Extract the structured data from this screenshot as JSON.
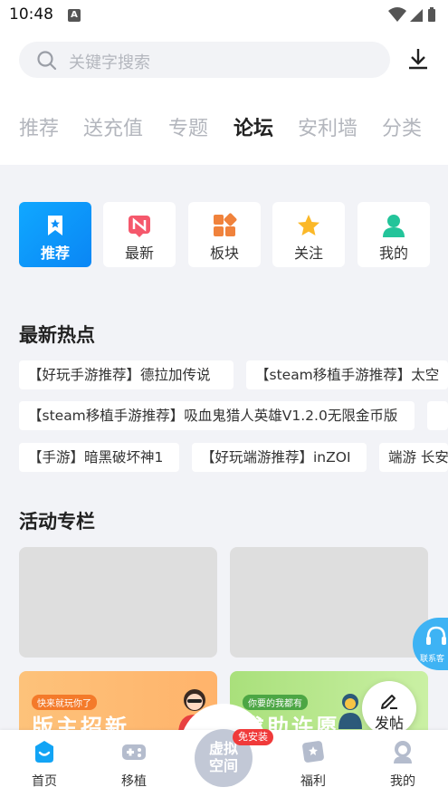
{
  "status_bar": {
    "time": "10:48",
    "notification_letter": "A"
  },
  "search": {
    "placeholder": "关键字搜索"
  },
  "tabs": [
    {
      "label": "推荐"
    },
    {
      "label": "送充值"
    },
    {
      "label": "专题"
    },
    {
      "label": "论坛",
      "active": true
    },
    {
      "label": "安利墙"
    },
    {
      "label": "分类"
    }
  ],
  "quick_nav": [
    {
      "label": "推荐",
      "icon": "bookmark-star-icon",
      "active": true
    },
    {
      "label": "最新",
      "icon": "new-badge-icon"
    },
    {
      "label": "板块",
      "icon": "blocks-icon"
    },
    {
      "label": "关注",
      "icon": "star-icon"
    },
    {
      "label": "我的",
      "icon": "user-icon"
    }
  ],
  "hot": {
    "title": "最新热点",
    "rows": [
      [
        "【好玩手游推荐】德拉加传说",
        "【steam移植手游推荐】太空"
      ],
      [
        "【steam移植手游推荐】吸血鬼猎人英雄V1.2.0无限金币版"
      ],
      [
        "【手游】暗黑破坏神1",
        "【好玩端游推荐】inZOI",
        "端游 长安"
      ]
    ]
  },
  "activity": {
    "title": "活动专栏",
    "promos": [
      {
        "tag": "快来就玩你了",
        "headline": "版主招新"
      },
      {
        "tag": "你要的我都有",
        "headline": "求助许愿"
      }
    ]
  },
  "floating": {
    "service_label": "联系客",
    "post_label": "发帖"
  },
  "bottom_nav": {
    "items": [
      {
        "label": "首页",
        "icon": "home-icon",
        "active": true
      },
      {
        "label": "移植",
        "icon": "gamepad-icon"
      },
      {
        "label": "福利",
        "icon": "gift-card-icon"
      },
      {
        "label": "我的",
        "icon": "profile-icon"
      }
    ],
    "center": {
      "line1": "虚拟",
      "line2": "空间",
      "badge": "免安装"
    }
  },
  "colors": {
    "accent": "#0a8ef7",
    "badge": "#f03a3a",
    "orange": "#f47a2a"
  }
}
